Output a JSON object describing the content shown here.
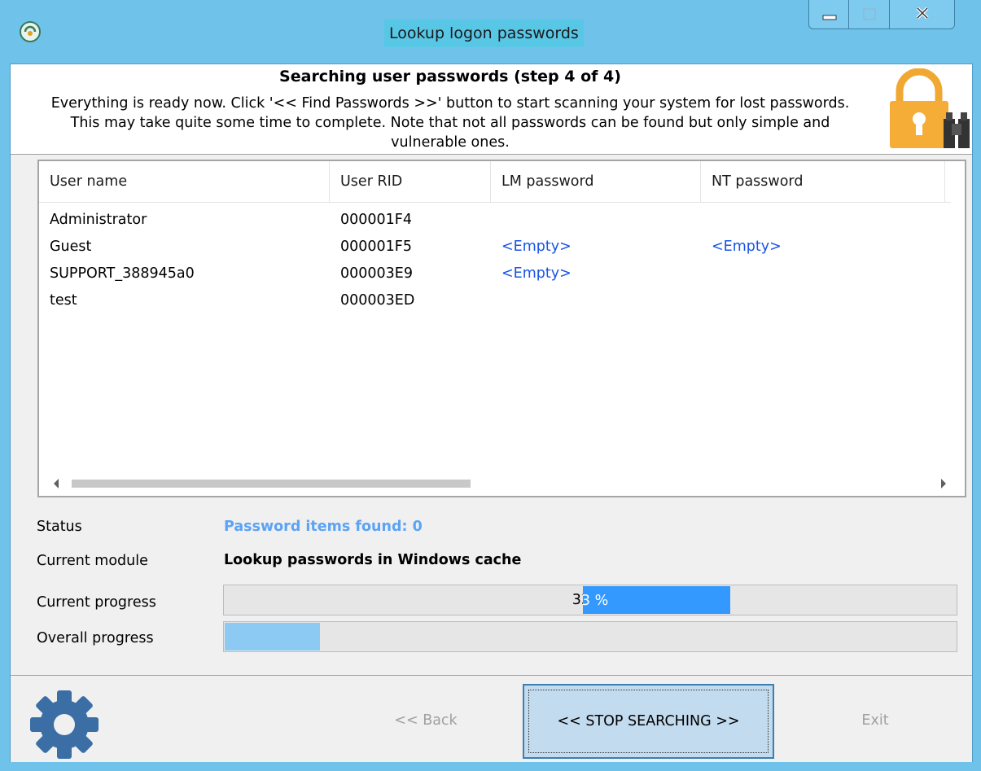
{
  "window": {
    "title": "Lookup logon passwords"
  },
  "header": {
    "title": "Searching user passwords (step 4 of 4)",
    "description": "Everything is ready now. Click '<< Find Passwords >>' button to start scanning your system for lost passwords. This may take quite some time to complete. Note that not all passwords can be found but only simple and vulnerable ones."
  },
  "list": {
    "columns": [
      "User name",
      "User RID",
      "LM password",
      "NT password"
    ],
    "rows": [
      {
        "user": "Administrator",
        "rid": "000001F4",
        "lm": "",
        "nt": ""
      },
      {
        "user": "Guest",
        "rid": "000001F5",
        "lm": "<Empty>",
        "nt": "<Empty>"
      },
      {
        "user": "SUPPORT_388945a0",
        "rid": "000003E9",
        "lm": "<Empty>",
        "nt": ""
      },
      {
        "user": "test",
        "rid": "000003ED",
        "lm": "",
        "nt": ""
      }
    ]
  },
  "status": {
    "status_label": "Status",
    "status_value": "Password items found:  0",
    "module_label": "Current module",
    "module_value": "Lookup passwords in Windows cache",
    "current_label": "Current progress",
    "current_fraction": 0.691,
    "current_text": "33 %",
    "overall_label": "Overall progress",
    "overall_fraction": 0.13
  },
  "footer": {
    "back_label": "<< Back",
    "stop_label": "<< STOP SEARCHING >>",
    "exit_label": "Exit"
  },
  "colors": {
    "titlebar": "#6fc3eb",
    "link": "#1a53e6",
    "status": "#5aa3f5",
    "progress_current": "#3399ff",
    "progress_overall": "#8ccaf4"
  }
}
